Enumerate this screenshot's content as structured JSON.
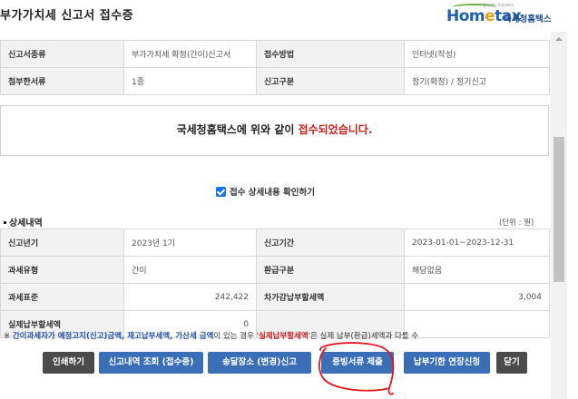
{
  "page": {
    "title": "부가가치세 신고서 접수증",
    "logo": {
      "home": "Hom",
      "e": "e",
      "tax": "tax",
      "tagline": "국세청홈택스",
      "tiny": "앞서가는 국세서비스"
    }
  },
  "summary": {
    "rows": [
      {
        "label1": "신고서종류",
        "value1": "부가가치세 확정(간이)신고서",
        "label2": "접수방법",
        "value2": "인터넷(작성)"
      },
      {
        "label1": "첨부한서류",
        "value1": "1종",
        "label2": "신고구분",
        "value2": "정기(확정) / 정기신고"
      }
    ]
  },
  "banner": {
    "prefix": "국세청홈택스에 위와 같이 ",
    "highlight": "접수되었습니다."
  },
  "confirm": {
    "label": "접수 상세내용 확인하기",
    "checked": true
  },
  "detail": {
    "title": "상세내역",
    "unit": "(단위 : 원)",
    "rows": [
      {
        "label1": "신고년기",
        "value1": "2023년 1기",
        "label2": "신고기간",
        "value2": "2023-01-01~2023-12-31"
      },
      {
        "label1": "과세유형",
        "value1": "간이",
        "label2": "환급구분",
        "value2": "해당없음"
      },
      {
        "label1": "과세표준",
        "value1": "242,422",
        "label2": "차가감납부할세액",
        "value2": "3,004"
      },
      {
        "label1": "실제납부할세액",
        "value1": "0",
        "label2": "",
        "value2": ""
      }
    ]
  },
  "note": {
    "star": "※ ",
    "blue": "간이과세자가 예정고지(신고)금액, 재고납부세액, 가산세 금액",
    "mid": "이 있는 경우 '",
    "red": "실제납부할세액",
    "end": "'은 실제 납부(환급)세액과 다를 수"
  },
  "buttons": [
    {
      "label": "인쇄하기"
    },
    {
      "label": "신고내역 조회 (접수증)"
    },
    {
      "label": "송달장소 (변경)신고"
    },
    {
      "label": "증빙서류 제출"
    },
    {
      "label": "납부기한 연장신청"
    },
    {
      "label": "닫기"
    }
  ],
  "colors": {
    "accent_red": "#c8201d",
    "button_blue": "#3a6fb8",
    "button_dark": "#4b4b4b",
    "annotation_red": "#e8141b"
  }
}
